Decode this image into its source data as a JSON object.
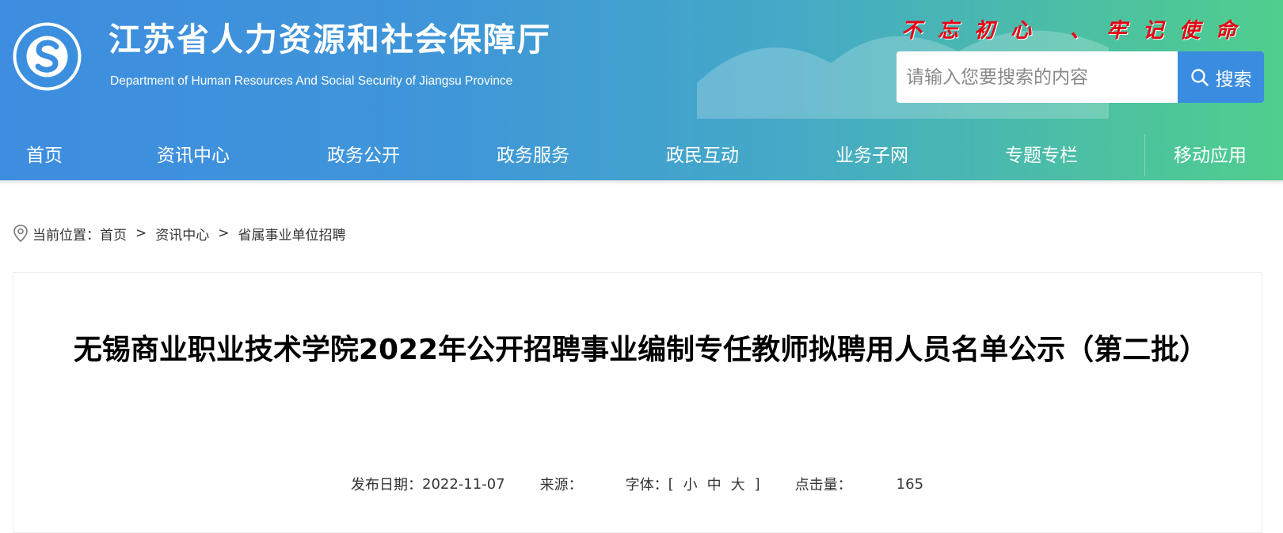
{
  "header": {
    "site_title": "江苏省人力资源和社会保障厅",
    "site_subtitle": "Department of Human Resources And Social Security of Jiangsu Province",
    "logo_text": "江苏省人力资源和社会保障厅",
    "slogan": "不忘初心 、牢记使命",
    "search": {
      "placeholder": "请输入您要搜索的内容",
      "button_label": "搜索"
    },
    "colors": {
      "gradient_start": "#3e8de0",
      "gradient_end": "#4fce8c",
      "slogan": "#e60012",
      "search_button": "#3a8ce0"
    }
  },
  "nav": {
    "items": [
      "首页",
      "资讯中心",
      "政务公开",
      "政务服务",
      "政民互动",
      "业务子网",
      "专题专栏",
      "移动应用"
    ]
  },
  "breadcrumb": {
    "prefix": "当前位置：",
    "items": [
      "首页",
      "资讯中心",
      "省属事业单位招聘"
    ],
    "separator": ">"
  },
  "article": {
    "title": "无锡商业职业技术学院2022年公开招聘事业编制专任教师拟聘用人员名单公示（第二批）",
    "meta": {
      "date_label": "发布日期：",
      "date_value": "2022-11-07",
      "source_label": "来源：",
      "source_value": "",
      "font_label": "字体：",
      "font_open": "[",
      "font_small": "小",
      "font_medium": "中",
      "font_large": "大",
      "font_close": "]",
      "hits_label": "点击量：",
      "hits_value": "165"
    }
  }
}
